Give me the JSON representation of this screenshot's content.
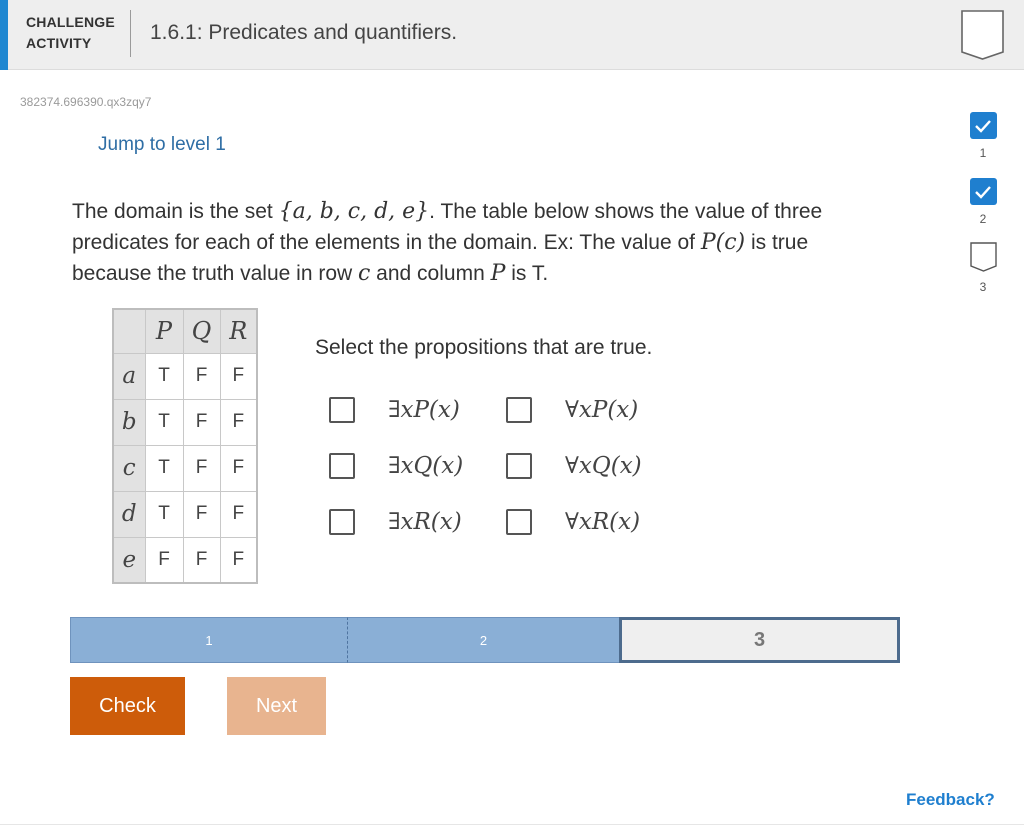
{
  "header": {
    "type_line1": "CHALLENGE",
    "type_line2": "ACTIVITY",
    "title": "1.6.1: Predicates and quantifiers.",
    "accent_color": "#1f87d1"
  },
  "activity_id": "382374.696390.qx3zqy7",
  "jump_link": "Jump to level 1",
  "levels": [
    {
      "number": "1",
      "completed": true,
      "icon": "check-icon"
    },
    {
      "number": "2",
      "completed": true,
      "icon": "check-icon"
    },
    {
      "number": "3",
      "completed": false,
      "icon": "empty-box-icon"
    }
  ],
  "description": {
    "p1": "The domain is the set ",
    "set": "{a, b, c, d, e}",
    "p2": ". The table below shows the value of three predicates for each of the elements in the domain. Ex: The value of ",
    "example": "P(c)",
    "p3": " is true because the truth value in row ",
    "row": "c",
    "p4": " and column ",
    "col": "P",
    "p5": " is T."
  },
  "table": {
    "columns": [
      "P",
      "Q",
      "R"
    ],
    "rows": [
      {
        "label": "a",
        "values": [
          "T",
          "F",
          "F"
        ]
      },
      {
        "label": "b",
        "values": [
          "T",
          "F",
          "F"
        ]
      },
      {
        "label": "c",
        "values": [
          "T",
          "F",
          "F"
        ]
      },
      {
        "label": "d",
        "values": [
          "T",
          "F",
          "F"
        ]
      },
      {
        "label": "e",
        "values": [
          "F",
          "F",
          "F"
        ]
      }
    ]
  },
  "prompt": "Select the propositions that are true.",
  "options": [
    {
      "quant": "∃",
      "body": "xP(x)",
      "checked": false
    },
    {
      "quant": "∀",
      "body": "xP(x)",
      "checked": false
    },
    {
      "quant": "∃",
      "body": "xQ(x)",
      "checked": false
    },
    {
      "quant": "∀",
      "body": "xQ(x)",
      "checked": false
    },
    {
      "quant": "∃",
      "body": "xR(x)",
      "checked": false
    },
    {
      "quant": "∀",
      "body": "xR(x)",
      "checked": false
    }
  ],
  "progress": {
    "seg1": "1",
    "seg2": "2",
    "seg3": "3",
    "current": 3
  },
  "buttons": {
    "check": "Check",
    "next": "Next"
  },
  "feedback": "Feedback?",
  "colors": {
    "primary": "#1f7fcf",
    "check_button": "#cd5c0a",
    "next_button_disabled": "#e8b48f",
    "progress_done": "#8aafd6"
  }
}
